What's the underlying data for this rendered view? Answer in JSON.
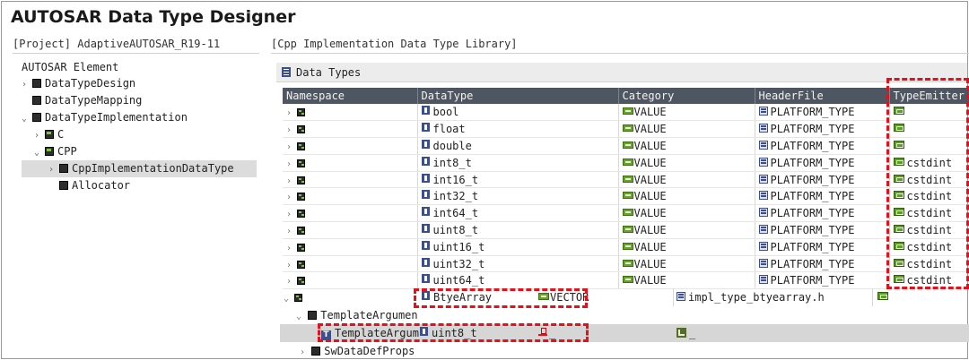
{
  "app": {
    "title": "AUTOSAR Data Type Designer"
  },
  "left_pane": {
    "project_label": "[Project] AdaptiveAUTOSAR_R19-11",
    "tree_title": "AUTOSAR Element",
    "items": [
      {
        "label": "DataTypeDesign",
        "chevron": "›"
      },
      {
        "label": "DataTypeMapping",
        "chevron": ""
      },
      {
        "label": "DataTypeImplementation",
        "chevron": "⌄"
      },
      {
        "label": "C",
        "chevron": "›"
      },
      {
        "label": "CPP",
        "chevron": "⌄"
      },
      {
        "label": "CppImplementationDataType",
        "chevron": "›"
      },
      {
        "label": "Allocator",
        "chevron": ""
      }
    ]
  },
  "right_pane": {
    "library_label": "[Cpp Implementation Data Type Library]",
    "section_title": "Data Types",
    "columns": [
      "Namespace",
      "DataType",
      "Category",
      "HeaderFile",
      "TypeEmitter"
    ],
    "rows": [
      {
        "datatype": "bool",
        "category": "VALUE",
        "header": "PLATFORM_TYPE",
        "emitter": ""
      },
      {
        "datatype": "float",
        "category": "VALUE",
        "header": "PLATFORM_TYPE",
        "emitter": ""
      },
      {
        "datatype": "double",
        "category": "VALUE",
        "header": "PLATFORM_TYPE",
        "emitter": ""
      },
      {
        "datatype": "int8_t",
        "category": "VALUE",
        "header": "PLATFORM_TYPE",
        "emitter": "cstdint"
      },
      {
        "datatype": "int16_t",
        "category": "VALUE",
        "header": "PLATFORM_TYPE",
        "emitter": "cstdint"
      },
      {
        "datatype": "int32_t",
        "category": "VALUE",
        "header": "PLATFORM_TYPE",
        "emitter": "cstdint"
      },
      {
        "datatype": "int64_t",
        "category": "VALUE",
        "header": "PLATFORM_TYPE",
        "emitter": "cstdint"
      },
      {
        "datatype": "uint8_t",
        "category": "VALUE",
        "header": "PLATFORM_TYPE",
        "emitter": "cstdint"
      },
      {
        "datatype": "uint16_t",
        "category": "VALUE",
        "header": "PLATFORM_TYPE",
        "emitter": "cstdint"
      },
      {
        "datatype": "uint32_t",
        "category": "VALUE",
        "header": "PLATFORM_TYPE",
        "emitter": "cstdint"
      },
      {
        "datatype": "uint64_t",
        "category": "VALUE",
        "header": "PLATFORM_TYPE",
        "emitter": "cstdint"
      }
    ],
    "vector_row": {
      "datatype": "BtyeArray",
      "category": "VECTOR",
      "header": "impl_type_btyearray.h"
    },
    "template_args": {
      "group_label": "TemplateArgumen",
      "arg_label": "TemplateArgum",
      "arg_letter": "T",
      "arg_type": "uint8_t",
      "arg_value1": "_",
      "arg_value2": "_"
    },
    "sw_props_label": "SwDataDefProps"
  },
  "colors": {
    "header_bg": "#4e5662",
    "highlight": "#e4101a",
    "selection": "#dcdcdc"
  }
}
